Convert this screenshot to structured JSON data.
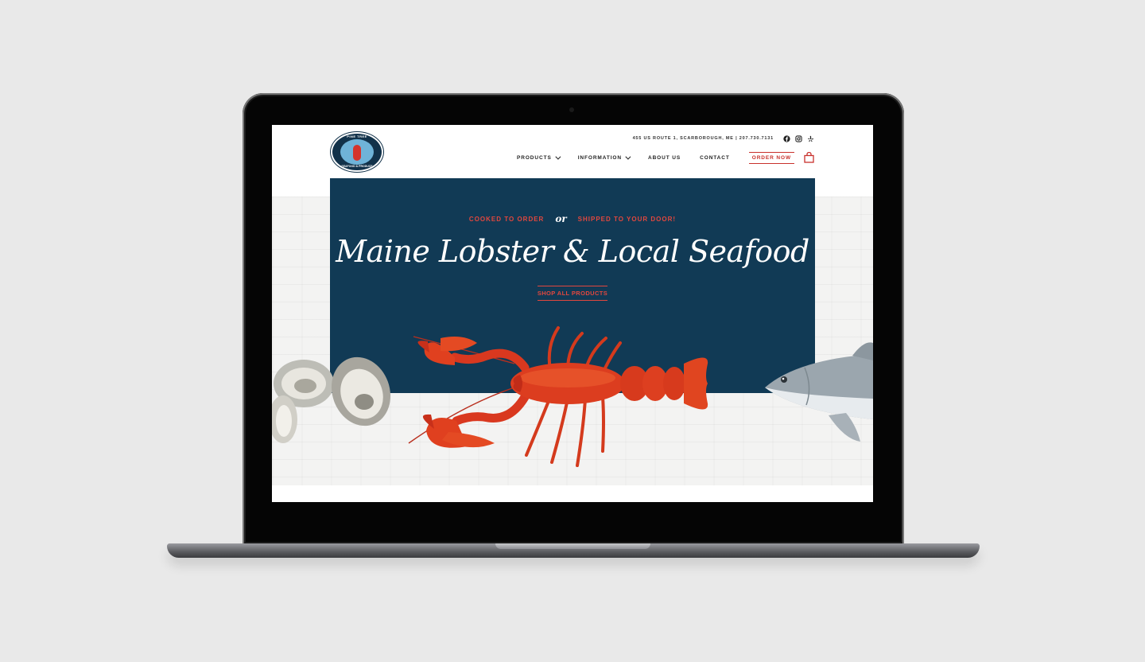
{
  "site": {
    "address": "455 US ROUTE 1, SCARBOROUGH, ME | 207.730.7131",
    "logo": {
      "top_text": "PINE TREE",
      "bottom_text": "SEAFOOD & PRODUCE"
    },
    "nav": {
      "items": [
        {
          "label": "PRODUCTS",
          "dropdown": true
        },
        {
          "label": "INFORMATION",
          "dropdown": true
        },
        {
          "label": "ABOUT US",
          "dropdown": false
        },
        {
          "label": "CONTACT",
          "dropdown": false
        }
      ],
      "order_label": "ORDER NOW"
    },
    "social": [
      "facebook-icon",
      "instagram-icon",
      "yelp-icon"
    ]
  },
  "hero": {
    "tag_left": "COOKED TO ORDER",
    "tag_or": "or",
    "tag_right": "SHIPPED TO YOUR DOOR!",
    "headline": "Maine Lobster & Local Seafood",
    "cta": "SHOP ALL PRODUCTS"
  },
  "colors": {
    "navy": "#113a55",
    "accent": "#e2473e"
  }
}
